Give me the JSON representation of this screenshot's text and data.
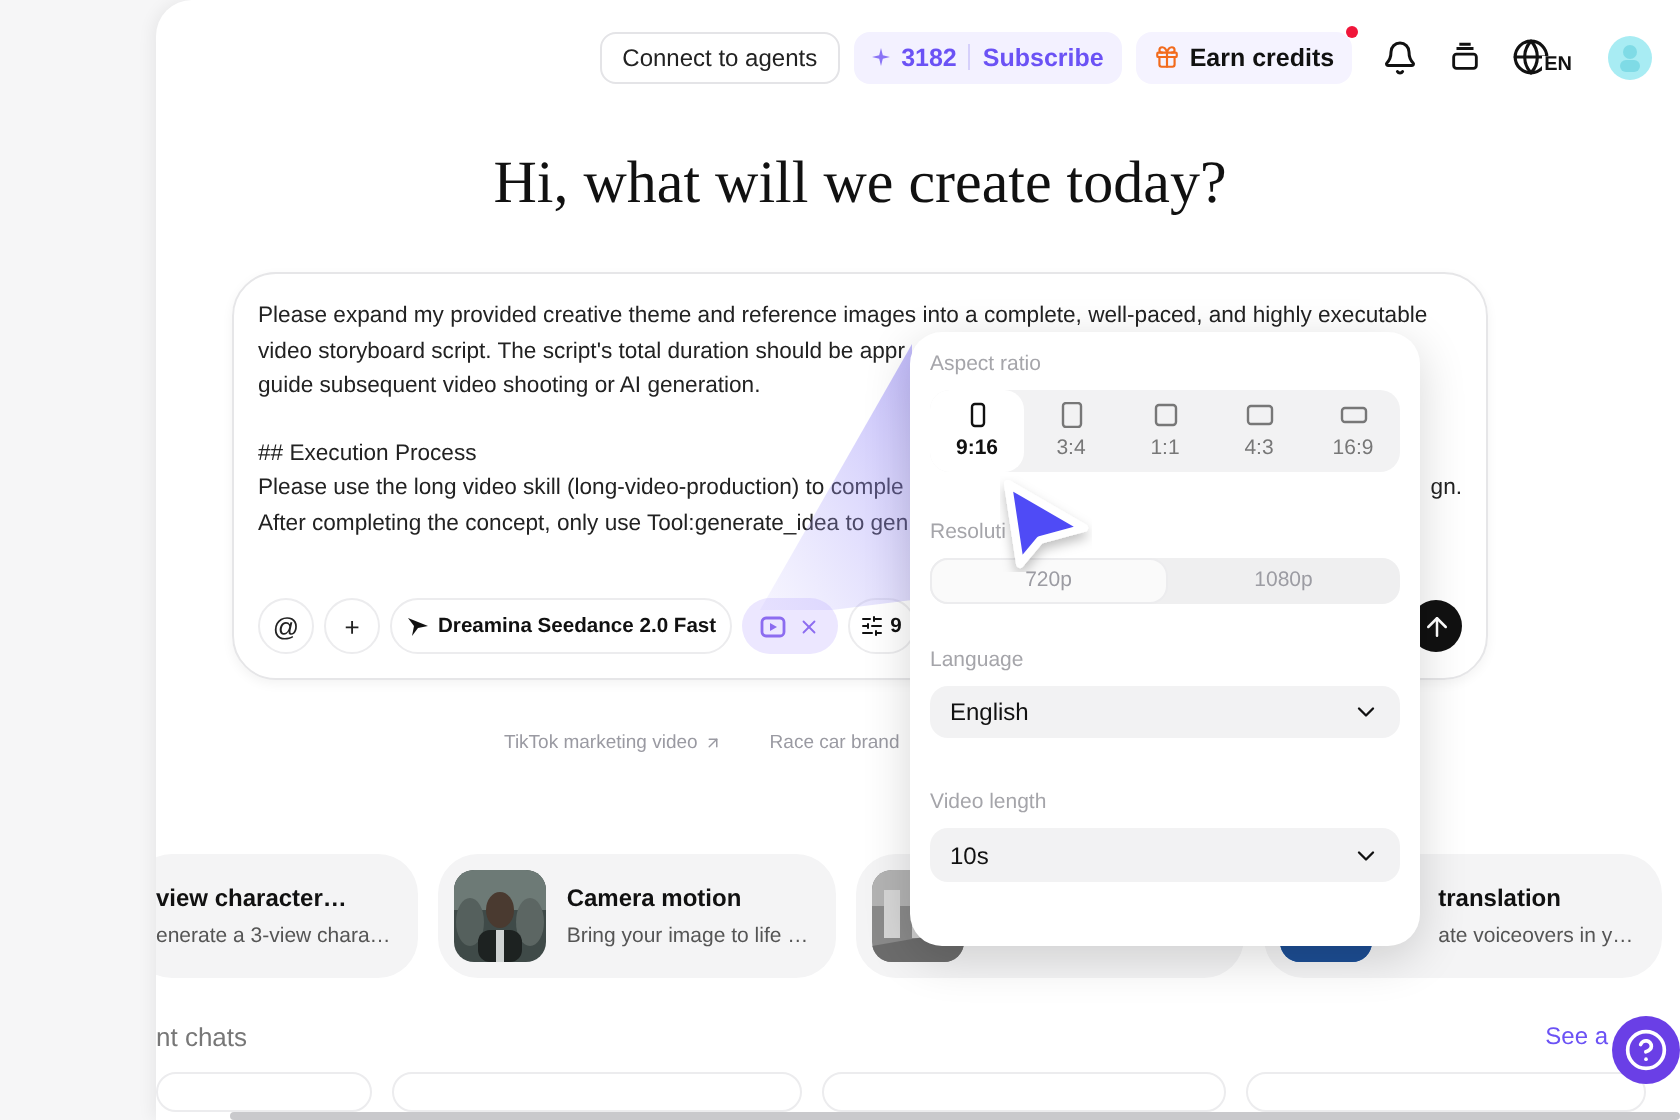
{
  "header": {
    "connect_button": "Connect to agents",
    "credits": "3182",
    "subscribe": "Subscribe",
    "earn_button": "Earn credits",
    "earn_notification": true,
    "language": "EN"
  },
  "heading": "Hi, what will we create today?",
  "prompt": {
    "paragraphs": [
      [
        {
          "text": "Please expand my provided creative theme and reference images into a complete, well-paced, and highly executable"
        },
        {
          "text": "video storyboard script. The script's total duration should be appr"
        },
        {
          "text": "guide subsequent video shooting or AI generation."
        }
      ],
      [
        {
          "text": "## Execution Process"
        },
        {
          "text": "Please use the long video skill (long-video-production) to comple",
          "tail": "gn."
        },
        {
          "text": "After completing the concept, only use Tool:generate_idea to gen"
        }
      ]
    ]
  },
  "toolbar": {
    "mention": "@",
    "add": "+",
    "model": "Dreamina Seedance 2.0 Fast",
    "settings": "9"
  },
  "suggestions": [
    {
      "label": "TikTok marketing video"
    },
    {
      "label": "Race car brand"
    }
  ],
  "cards": [
    {
      "title": "view character…",
      "subtitle": "enerate a 3-view chara…"
    },
    {
      "title": "Camera motion",
      "subtitle": "Bring your image to life …",
      "thumbnail": {
        "kind": "picture"
      }
    },
    {
      "thumbnail": {
        "kind": "picture"
      }
    },
    {
      "title": "translation",
      "subtitle": "ate voiceovers in y…",
      "thumbnail": {
        "kind": "picture"
      }
    }
  ],
  "recent": {
    "title": "nt chats",
    "link": "See a"
  },
  "popover": {
    "aspect_label": "Aspect ratio",
    "aspect_options": [
      {
        "label": "9:16",
        "selected": true
      },
      {
        "label": "3:4",
        "selected": false
      },
      {
        "label": "1:1",
        "selected": false
      },
      {
        "label": "4:3",
        "selected": false
      },
      {
        "label": "16:9",
        "selected": false
      }
    ],
    "resolution_label": "Resoluti",
    "resolution_disabled": true,
    "resolution_options": [
      {
        "label": "720p",
        "selected": true
      },
      {
        "label": "1080p",
        "selected": false
      }
    ],
    "language_label": "Language",
    "language": "English",
    "length_label": "Video length",
    "length": "10s"
  }
}
